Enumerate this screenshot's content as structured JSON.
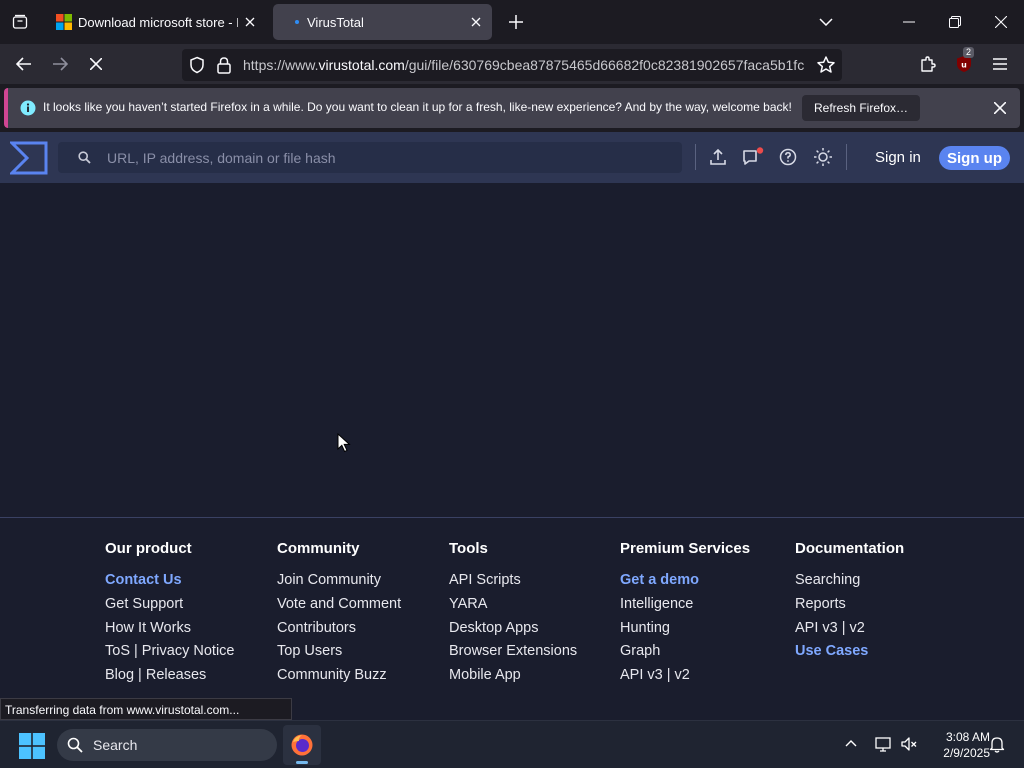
{
  "browser": {
    "tabs": [
      {
        "title": "Download microsoft store - Mic",
        "active": false
      },
      {
        "title": "VirusTotal",
        "active": true
      }
    ],
    "url": {
      "prefix": "https://www.",
      "domain": "virustotal.com",
      "path": "/gui/file/630769cbea87875465d66682f0c82381902657faca5b1fc"
    },
    "extension_badge": "2",
    "notification": {
      "message": "It looks like you haven’t started Firefox in a while. Do you want to clean it up for a fresh, like-new experience? And by the way, welcome back!",
      "button": "Refresh Firefox…"
    },
    "status_text": "Transferring data from www.virustotal.com..."
  },
  "vt": {
    "search_placeholder": "URL, IP address, domain or file hash",
    "signin": "Sign in",
    "signup": "Sign up",
    "accent_color": "#5a84f0"
  },
  "footer": {
    "columns": [
      {
        "heading": "Our product",
        "links": [
          {
            "label": "Contact Us",
            "highlight": true
          },
          {
            "label": "Get Support"
          },
          {
            "label": "How It Works"
          },
          {
            "label": "ToS | Privacy Notice"
          },
          {
            "label": "Blog | Releases"
          }
        ]
      },
      {
        "heading": "Community",
        "links": [
          {
            "label": "Join Community"
          },
          {
            "label": "Vote and Comment"
          },
          {
            "label": "Contributors"
          },
          {
            "label": "Top Users"
          },
          {
            "label": "Community Buzz"
          }
        ]
      },
      {
        "heading": "Tools",
        "links": [
          {
            "label": "API Scripts"
          },
          {
            "label": "YARA"
          },
          {
            "label": "Desktop Apps"
          },
          {
            "label": "Browser Extensions"
          },
          {
            "label": "Mobile App"
          }
        ]
      },
      {
        "heading": "Premium Services",
        "links": [
          {
            "label": "Get a demo",
            "highlight": true
          },
          {
            "label": "Intelligence"
          },
          {
            "label": "Hunting"
          },
          {
            "label": "Graph"
          },
          {
            "label": "API v3 | v2"
          }
        ]
      },
      {
        "heading": "Documentation",
        "links": [
          {
            "label": "Searching"
          },
          {
            "label": "Reports"
          },
          {
            "label": "API v3 | v2"
          },
          {
            "label": "Use Cases",
            "highlight": true
          }
        ]
      }
    ]
  },
  "taskbar": {
    "search_label": "Search",
    "time": "3:08 AM",
    "date": "2/9/2025"
  }
}
